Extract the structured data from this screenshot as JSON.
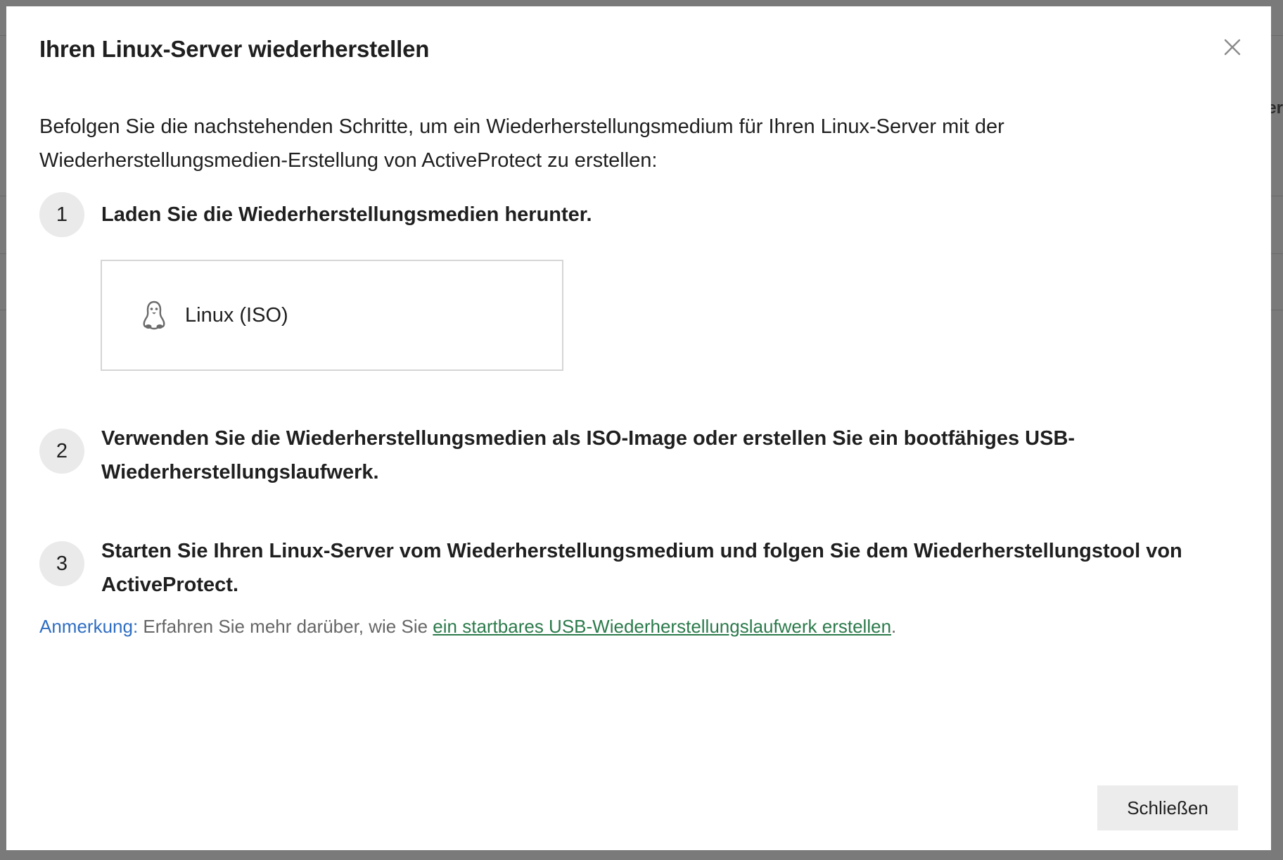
{
  "background": {
    "peek_text": "er"
  },
  "dialog": {
    "title": "Ihren Linux-Server wiederherstellen",
    "intro": "Befolgen Sie die nachstehenden Schritte, um ein Wiederherstellungsmedium für Ihren Linux-Server mit der Wiederherstellungsmedien-Erstellung von ActiveProtect zu erstellen:",
    "steps": [
      {
        "number": "1",
        "text": "Laden Sie die Wiederherstellungsmedien herunter."
      },
      {
        "number": "2",
        "text": "Verwenden Sie die Wiederherstellungsmedien als ISO-Image oder erstellen Sie ein bootfähiges USB-Wiederherstellungslaufwerk."
      },
      {
        "number": "3",
        "text": "Starten Sie Ihren Linux-Server vom Wiederherstellungsmedium und folgen Sie dem Wiederherstellungstool von ActiveProtect."
      }
    ],
    "download": {
      "icon": "linux-penguin-icon",
      "label": "Linux (ISO)"
    },
    "note": {
      "label": "Anmerkung:",
      "text": " Erfahren Sie mehr darüber, wie Sie ",
      "link_text": "ein startbares USB-Wiederherstellungslaufwerk erstellen",
      "suffix": "."
    },
    "close_button_label": "Schließen",
    "close_icon": "close-icon"
  },
  "colors": {
    "note_label": "#2f6ec2",
    "link": "#2b7a4b",
    "step_circle": "#eaeaea",
    "button_bg": "#ececec"
  }
}
